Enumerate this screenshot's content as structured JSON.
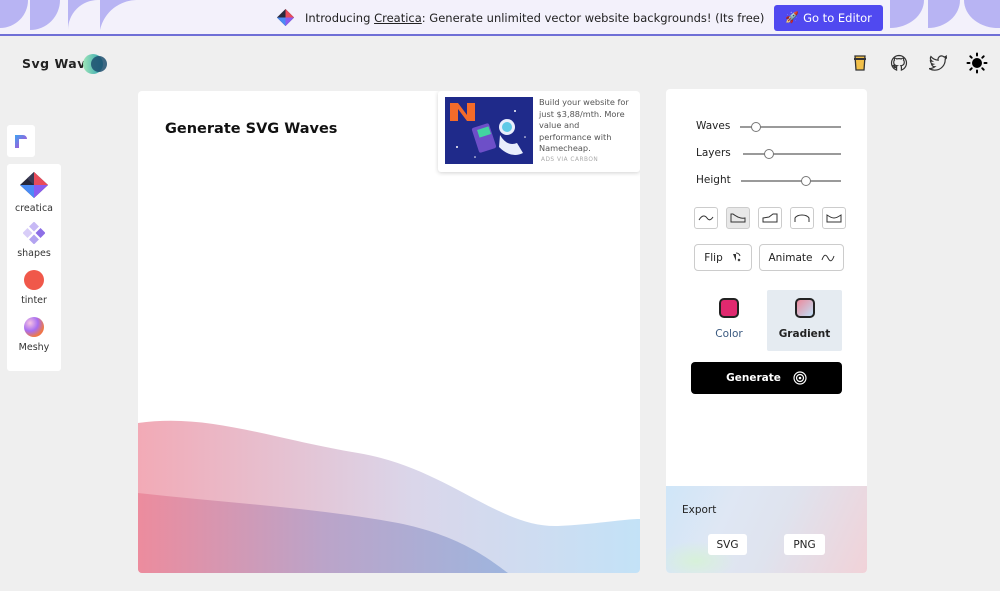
{
  "banner": {
    "intro": "Introducing ",
    "link": "Creatica",
    "tail": ": Generate unlimited vector website backgrounds! (Its free)",
    "button_label": "Go to Editor",
    "button_icon": "rocket-icon",
    "accent": "#5049f0"
  },
  "header": {
    "logo": "Svg Wave",
    "icons": [
      "coffee-icon",
      "github-icon",
      "twitter-icon",
      "sun-icon"
    ]
  },
  "sidebar": {
    "items": [
      {
        "label": "creatica",
        "icon": "creatica-icon"
      },
      {
        "label": "shapes",
        "icon": "shapes-icon"
      },
      {
        "label": "tinter",
        "icon": "tinter-icon"
      },
      {
        "label": "Meshy",
        "icon": "meshy-icon"
      }
    ]
  },
  "preview": {
    "title": "Generate SVG Waves",
    "gradient_from": "#ec8a9c",
    "gradient_to": "#bfe0f7"
  },
  "ad": {
    "text": "Build your website for just $3,88/mth. More value and performance with Namecheap.",
    "via": "ADS VIA CARBON"
  },
  "controls": {
    "sliders": [
      {
        "label": "Waves",
        "value": 0.16
      },
      {
        "label": "Layers",
        "value": 0.27
      },
      {
        "label": "Height",
        "value": 0.65
      }
    ],
    "shape_options": [
      "wave-shape-1",
      "wave-shape-2",
      "wave-shape-3",
      "wave-shape-4",
      "wave-shape-5"
    ],
    "active_shape": 1,
    "flip_label": "Flip",
    "animate_label": "Animate",
    "color_label": "Color",
    "color_value": "#e0296f",
    "gradient_label": "Gradient",
    "generate_label": "Generate"
  },
  "export": {
    "label": "Export",
    "svg_label": "SVG",
    "png_label": "PNG"
  }
}
